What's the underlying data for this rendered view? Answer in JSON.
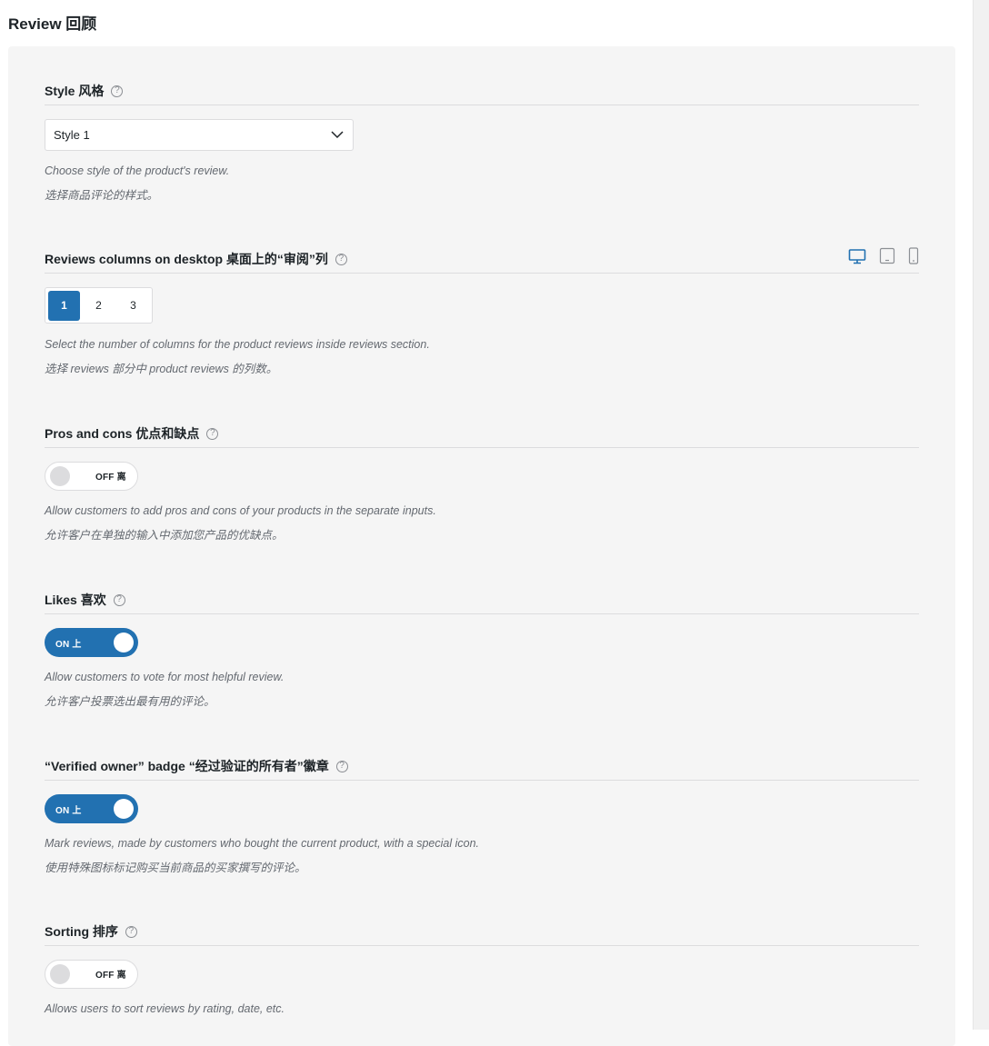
{
  "page": {
    "title": "Review  回顾"
  },
  "style": {
    "title": "Style  风格",
    "help": "?",
    "select_value": "Style 1",
    "desc_en": "Choose style of the product's review.",
    "desc_zh": "选择商品评论的样式。"
  },
  "columns": {
    "title": "Reviews columns on desktop  桌面上的“审阅”列",
    "help": "?",
    "options": [
      "1",
      "2",
      "3"
    ],
    "selected": "1",
    "devices": [
      "desktop-icon",
      "tablet-icon",
      "mobile-icon"
    ],
    "desc_en": "Select the number of columns for the product reviews inside reviews section.",
    "desc_zh": "选择 reviews 部分中 product reviews 的列数。"
  },
  "pros_cons": {
    "title": "Pros and cons  优点和缺点",
    "help": "?",
    "toggle_label": "OFF  离",
    "state": "off",
    "desc_en": "Allow customers to add pros and cons of your products in the separate inputs.",
    "desc_zh": "允许客户在单独的输入中添加您产品的优缺点。"
  },
  "likes": {
    "title": "Likes  喜欢",
    "help": "?",
    "toggle_label": "ON  上",
    "state": "on",
    "desc_en": "Allow customers to vote for most helpful review.",
    "desc_zh": "允许客户投票选出最有用的评论。"
  },
  "verified": {
    "title": "“Verified owner” badge  “经过验证的所有者”徽章",
    "help": "?",
    "toggle_label": "ON  上",
    "state": "on",
    "desc_en": "Mark reviews, made by customers who bought the current product, with a special icon.",
    "desc_zh": "使用特殊图标标记购买当前商品的买家撰写的评论。"
  },
  "sorting": {
    "title": "Sorting  排序",
    "help": "?",
    "toggle_label": "OFF  离",
    "state": "off",
    "desc_en": "Allows users to sort reviews by rating, date, etc."
  },
  "colors": {
    "accent": "#2271b1",
    "panel": "#f5f5f5",
    "muted": "#646970"
  }
}
